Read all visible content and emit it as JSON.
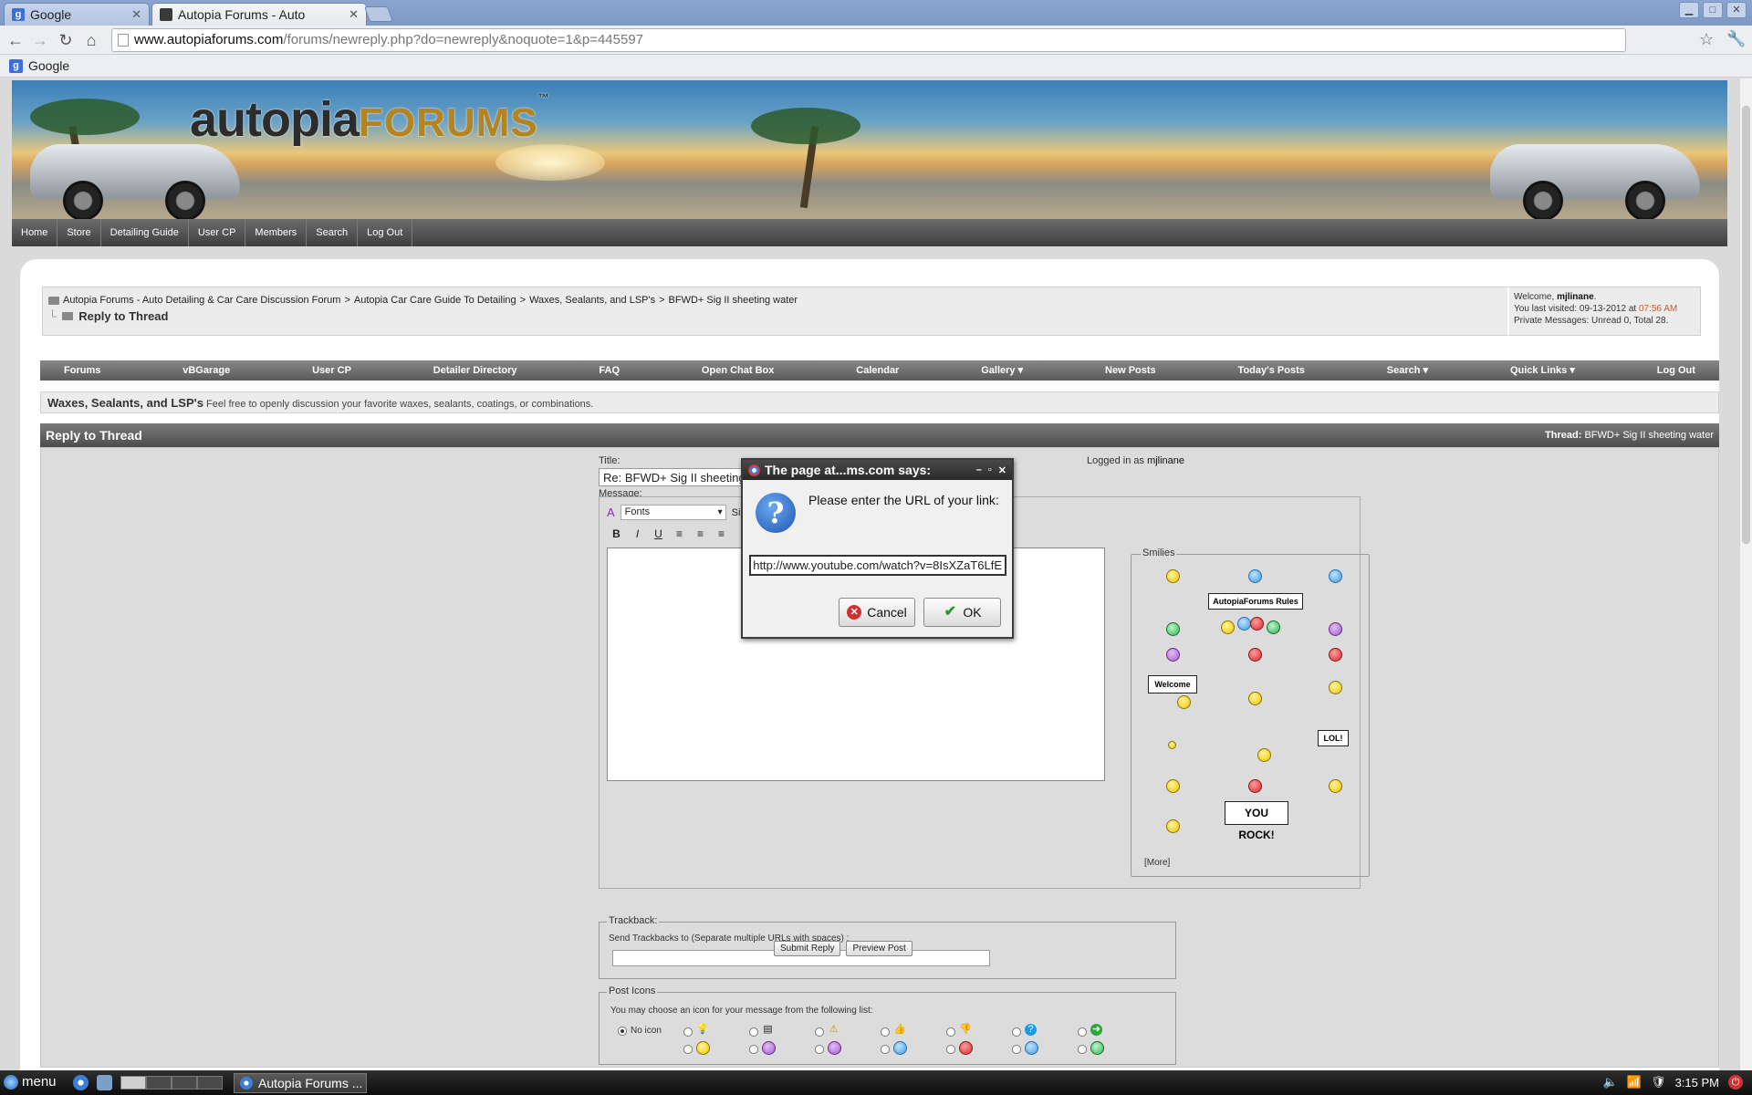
{
  "browser": {
    "tabs": [
      {
        "title": "Google",
        "active": false
      },
      {
        "title": "Autopia Forums - Auto",
        "active": true
      }
    ],
    "url_host": "www.autopiaforums.com",
    "url_path": "/forums/newreply.php?do=newreply&noquote=1&p=445597",
    "bookmarks": [
      {
        "label": "Google"
      }
    ]
  },
  "banner": {
    "logo_main": "autopia",
    "logo_accent": "FORUMS",
    "tm": "™",
    "reg": "®"
  },
  "topnav": [
    "Home",
    "Store",
    "Detailing Guide",
    "User CP",
    "Members",
    "Search",
    "Log Out"
  ],
  "breadcrumb": {
    "items": [
      "Autopia Forums - Auto Detailing & Car Care Discussion Forum",
      "Autopia Car Care Guide To Detailing",
      "Waxes, Sealants, and LSP's",
      "BFWD+ Sig II sheeting water"
    ],
    "separator": ">",
    "current": "Reply to Thread"
  },
  "welcome": {
    "prefix": "Welcome,",
    "user": "mjlinane",
    "suffix": ".",
    "last_visited_label": "You last visited: 09-13-2012 at",
    "last_visited_time": "07:56 AM",
    "pm_label": "Private Messages:",
    "pm_value": "Unread 0, Total 28."
  },
  "menubar": [
    "Forums",
    "vBGarage",
    "User CP",
    "Detailer Directory",
    "FAQ",
    "Open Chat Box",
    "Calendar",
    "Gallery ▾",
    "New Posts",
    "Today's Posts",
    "Search ▾",
    "Quick Links ▾",
    "Log Out"
  ],
  "forum": {
    "name": "Waxes, Sealants, and LSP's",
    "description": "Feel free to openly discussion your favorite waxes, sealants, coatings, or combinations."
  },
  "reply": {
    "header": "Reply to Thread",
    "thread_label": "Thread:",
    "thread_title": "BFWD+ Sig II sheeting water",
    "title_label": "Title:",
    "title_value": "Re: BFWD+ Sig II sheeting w",
    "logged_in_label": "Logged in as",
    "logged_in_user": "mjlinane",
    "message_label": "Message:",
    "fonts_select": "Fonts",
    "size_label": "Size",
    "smilies_legend": "Smilies",
    "rules_sign": "AutopiaForums Rules",
    "welcome_sign": "Welcome",
    "lol_sign": "LOL!",
    "rock_sign": "YOU ROCK!",
    "more_link": "[More]",
    "trackback_legend": "Trackback:",
    "trackback_text": "Send Trackbacks to (Separate multiple URLs with spaces) :",
    "posticons_legend": "Post Icons",
    "posticons_text": "You may choose an icon for your message from the following list:",
    "no_icon_label": "No icon",
    "submit_label": "Submit Reply",
    "preview_label": "Preview Post"
  },
  "dialog": {
    "title": "The page at...ms.com says:",
    "message": "Please enter the URL of your link:",
    "input_value": "http://www.youtube.com/watch?v=8IsXZaT6LfE",
    "cancel_label": "Cancel",
    "ok_label": "OK"
  },
  "taskbar": {
    "menu_label": "menu",
    "task_label": "Autopia Forums ...",
    "clock": "3:15 PM"
  },
  "colors": {
    "accent_time": "#d05a2a",
    "header_gray": "#5a5a5a",
    "logo_gold": "#b3841f"
  }
}
